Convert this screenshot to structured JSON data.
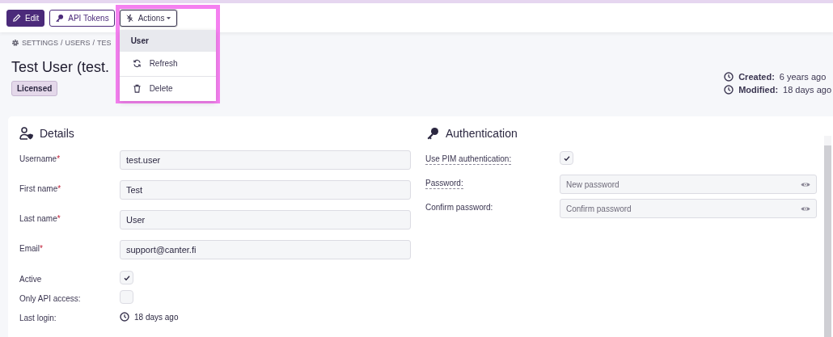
{
  "toolbar": {
    "buttons": [
      {
        "kind": "primary",
        "label": "Edit"
      },
      {
        "kind": "outline",
        "label": "API Tokens"
      },
      {
        "kind": "dropdown",
        "label": "Actions",
        "expanded": true
      }
    ]
  },
  "actions_menu": {
    "header": "User",
    "items": [
      {
        "label": "Refresh"
      },
      {
        "label": "Delete"
      }
    ]
  },
  "breadcrumb": [
    "SETTINGS",
    "USERS",
    "TES"
  ],
  "breadcrumb_separator": "/",
  "title": "Test User (test.",
  "badge": "Licensed",
  "meta": [
    {
      "label": "Created:",
      "value": "6 years ago"
    },
    {
      "label": "Modified:",
      "value": "18 days ago"
    }
  ],
  "details": {
    "title": "Details",
    "fields": [
      {
        "kind": "text",
        "label": "Username",
        "required_mark": "*",
        "value": "test.user"
      },
      {
        "kind": "text",
        "label": "First name",
        "required_mark": "*",
        "value": "Test"
      },
      {
        "kind": "text",
        "label": "Last name",
        "required_mark": "*",
        "value": "User"
      },
      {
        "kind": "text",
        "label": "Email",
        "required_mark": "*",
        "value": "support@canter.fi"
      },
      {
        "kind": "checkbox",
        "label": "Active",
        "checked": true
      },
      {
        "kind": "checkbox",
        "label": "Only API access:",
        "checked": false
      },
      {
        "kind": "time",
        "label": "Last login:",
        "value": "18 days ago"
      }
    ]
  },
  "authentication": {
    "title": "Authentication",
    "fields": [
      {
        "kind": "checkbox",
        "label": "Use PIM authentication:",
        "has_tooltip": true,
        "checked": true
      },
      {
        "kind": "password",
        "label": "Password:",
        "has_tooltip": true,
        "placeholder": "New password"
      },
      {
        "kind": "password",
        "label": "Confirm password:",
        "has_tooltip": false,
        "placeholder": "Confirm password"
      }
    ]
  }
}
